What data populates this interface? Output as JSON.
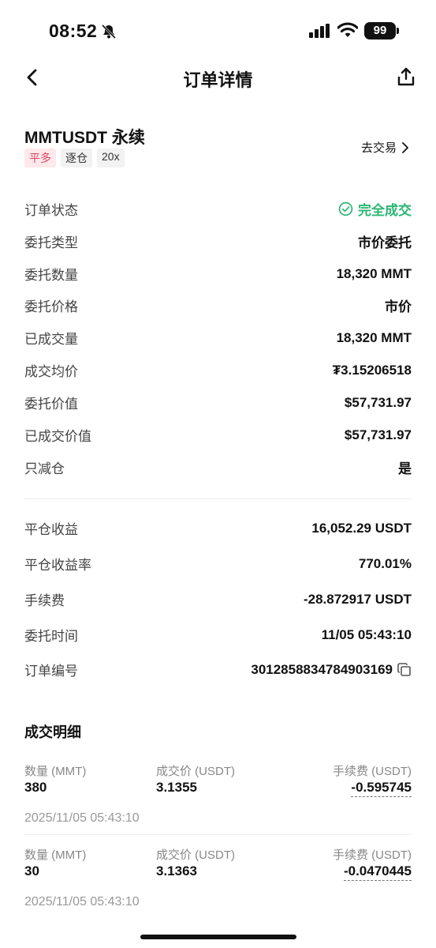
{
  "status_bar": {
    "time": "08:52",
    "battery": "99"
  },
  "nav": {
    "title": "订单详情"
  },
  "order": {
    "symbol": "MMTUSDT 永续",
    "tags": [
      "平多",
      "逐仓",
      "20x"
    ],
    "go_trade": "去交易"
  },
  "details": [
    {
      "label": "订单状态",
      "value": "完全成交"
    },
    {
      "label": "委托类型",
      "value": "市价委托"
    },
    {
      "label": "委托数量",
      "value": "18,320 MMT"
    },
    {
      "label": "委托价格",
      "value": "市价"
    },
    {
      "label": "已成交量",
      "value": "18,320 MMT"
    },
    {
      "label": "成交均价",
      "value": "₮3.15206518"
    },
    {
      "label": "委托价值",
      "value": "$57,731.97"
    },
    {
      "label": "已成交价值",
      "value": "$57,731.97"
    },
    {
      "label": "只减仓",
      "value": "是"
    }
  ],
  "pnl": [
    {
      "label": "平仓收益",
      "value": "16,052.29 USDT"
    },
    {
      "label": "平仓收益率",
      "value": "770.01%"
    },
    {
      "label": "手续费",
      "value": "-28.872917 USDT"
    },
    {
      "label": "委托时间",
      "value": "11/05 05:43:10"
    },
    {
      "label": "订单编号",
      "value": "3012858834784903169"
    }
  ],
  "fills_section": {
    "title": "成交明细",
    "headers": {
      "qty": "数量 (MMT)",
      "price": "成交价 (USDT)",
      "fee": "手续费 (USDT)"
    },
    "items": [
      {
        "qty": "380",
        "price": "3.1355",
        "fee": "-0.595745",
        "time": "2025/11/05 05:43:10"
      },
      {
        "qty": "30",
        "price": "3.1363",
        "fee": "-0.0470445",
        "time": "2025/11/05 05:43:10"
      }
    ]
  }
}
